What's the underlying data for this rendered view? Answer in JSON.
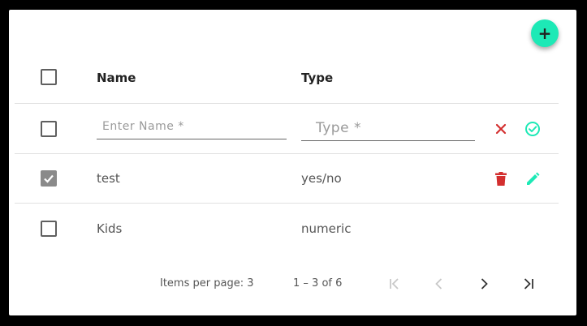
{
  "fab": {
    "label": "+"
  },
  "table": {
    "headers": {
      "name": "Name",
      "type": "Type"
    },
    "new_row": {
      "name_placeholder": "Enter Name *",
      "type_placeholder": "Type *"
    },
    "rows": [
      {
        "name": "test",
        "type": "yes/no",
        "checked": true
      },
      {
        "name": "Kids",
        "type": "numeric",
        "checked": false
      }
    ]
  },
  "paginator": {
    "items_per_page_label": "Items per page: 3",
    "range_label": "1 – 3 of 6"
  },
  "colors": {
    "accent": "#1de9b6",
    "danger": "#d32f2f",
    "checkbox_checked": "#8a8a8a"
  },
  "icons": {
    "fab": "plus-icon",
    "cancel": "close-icon",
    "confirm": "check-circle-icon",
    "delete": "trash-icon",
    "edit": "pencil-icon",
    "first": "first-page-icon",
    "prev": "chevron-left-icon",
    "next": "chevron-right-icon",
    "last": "last-page-icon"
  }
}
